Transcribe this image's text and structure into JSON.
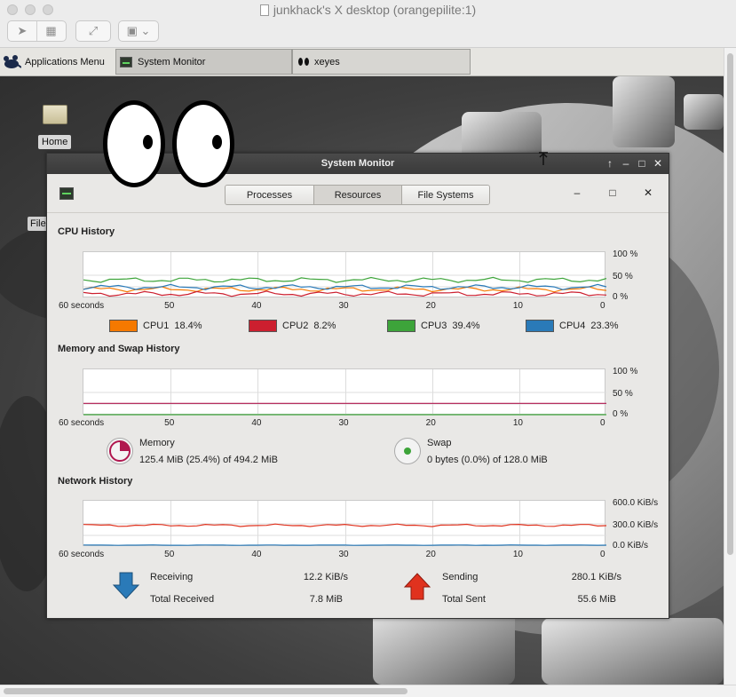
{
  "viewer": {
    "title": "junkhack's X desktop (orangepilite:1)"
  },
  "panel": {
    "apps_menu": "Applications Menu",
    "tasks": [
      {
        "label": "System Monitor"
      },
      {
        "label": "xeyes"
      }
    ]
  },
  "desktop": {
    "home_label": "Home",
    "file_label": "File"
  },
  "window": {
    "title": "System Monitor",
    "tabs": [
      "Processes",
      "Resources",
      "File Systems"
    ],
    "active_tab": "Resources"
  },
  "cpu": {
    "title": "CPU History",
    "y_ticks": [
      "100 %",
      "50 %",
      "0 %"
    ],
    "x_ticks": [
      "60 seconds",
      "50",
      "40",
      "30",
      "20",
      "10",
      "0"
    ],
    "cores": [
      {
        "name": "CPU1",
        "value": "18.4%",
        "color": "#f57900"
      },
      {
        "name": "CPU2",
        "value": "8.2%",
        "color": "#cc1f2f"
      },
      {
        "name": "CPU3",
        "value": "39.4%",
        "color": "#3da43a"
      },
      {
        "name": "CPU4",
        "value": "23.3%",
        "color": "#2a7ab8"
      }
    ]
  },
  "memory": {
    "title": "Memory and Swap History",
    "y_ticks": [
      "100 %",
      "50 %",
      "0 %"
    ],
    "x_ticks": [
      "60 seconds",
      "50",
      "40",
      "30",
      "20",
      "10",
      "0"
    ],
    "mem_label": "Memory",
    "mem_value": "125.4 MiB (25.4%) of 494.2 MiB",
    "mem_color": "#b0174f",
    "swap_label": "Swap",
    "swap_value": "0 bytes (0.0%) of 128.0 MiB",
    "swap_color": "#3da43a"
  },
  "network": {
    "title": "Network History",
    "y_ticks": [
      "600.0 KiB/s",
      "300.0 KiB/s",
      "0.0 KiB/s"
    ],
    "x_ticks": [
      "60 seconds",
      "50",
      "40",
      "30",
      "20",
      "10",
      "0"
    ],
    "receiving_label": "Receiving",
    "receiving_value": "12.2 KiB/s",
    "total_received_label": "Total Received",
    "total_received_value": "7.8 MiB",
    "sending_label": "Sending",
    "sending_value": "280.1 KiB/s",
    "total_sent_label": "Total Sent",
    "total_sent_value": "55.6 MiB"
  }
}
